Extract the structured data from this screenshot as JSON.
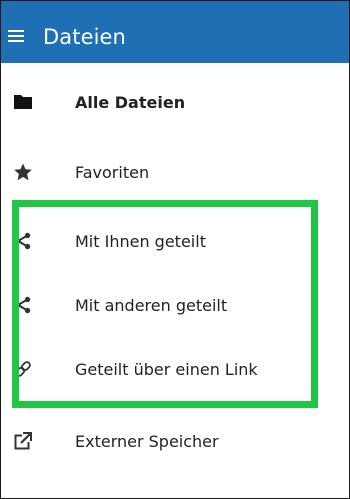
{
  "header": {
    "title": "Dateien",
    "background_color": "#1f6fb4",
    "menu_icon": "hamburger-menu-icon"
  },
  "nav": {
    "items": [
      {
        "label": "Alle Dateien",
        "icon": "folder-icon",
        "active": true
      },
      {
        "label": "Favoriten",
        "icon": "star-icon",
        "active": false
      },
      {
        "label": "Mit Ihnen geteilt",
        "icon": "share-icon",
        "active": false
      },
      {
        "label": "Mit anderen geteilt",
        "icon": "share-icon",
        "active": false
      },
      {
        "label": "Geteilt über einen Link",
        "icon": "link-icon",
        "active": false
      },
      {
        "label": "Externer Speicher",
        "icon": "external-storage-icon",
        "active": false
      }
    ]
  },
  "colors": {
    "header": "#1f6fb4",
    "highlight": "#22c645",
    "text": "#222222",
    "icon": "#222222"
  }
}
